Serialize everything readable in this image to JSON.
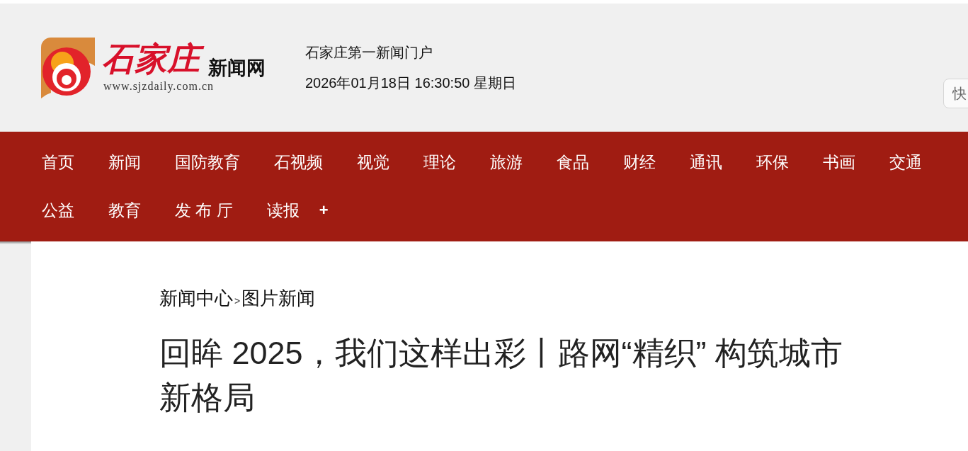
{
  "logo": {
    "name": "石家庄",
    "suffix": "新闻网",
    "url": "www.sjzdaily.com.cn"
  },
  "header": {
    "slogan": "石家庄第一新闻门户",
    "datetime": "2026年01月18日 16:30:50 星期日"
  },
  "search": {
    "placeholder": "快"
  },
  "nav": [
    {
      "label": "首页",
      "kind": "link"
    },
    {
      "label": "新闻",
      "kind": "link"
    },
    {
      "label": "国防教育",
      "kind": "link"
    },
    {
      "label": "石视频",
      "kind": "link"
    },
    {
      "label": "视觉",
      "kind": "link"
    },
    {
      "label": "理论",
      "kind": "link"
    },
    {
      "label": "旅游",
      "kind": "link"
    },
    {
      "label": "食品",
      "kind": "link"
    },
    {
      "label": "财经",
      "kind": "link"
    },
    {
      "label": "通讯",
      "kind": "link"
    },
    {
      "label": "环保",
      "kind": "link"
    },
    {
      "label": "书画",
      "kind": "link"
    },
    {
      "label": "交通",
      "kind": "link"
    },
    {
      "label": "公益",
      "kind": "link"
    },
    {
      "label": "教育",
      "kind": "link"
    },
    {
      "label": "发 布 厅",
      "kind": "link"
    },
    {
      "label": "读报",
      "kind": "link"
    },
    {
      "label": "+",
      "kind": "more"
    }
  ],
  "breadcrumb": [
    {
      "label": "新闻中心"
    },
    {
      "label": "图片新闻"
    }
  ],
  "breadcrumb_separator": ">",
  "article": {
    "title": "回眸 2025，我们这样出彩丨路网“精织” 构筑城市新格局"
  }
}
